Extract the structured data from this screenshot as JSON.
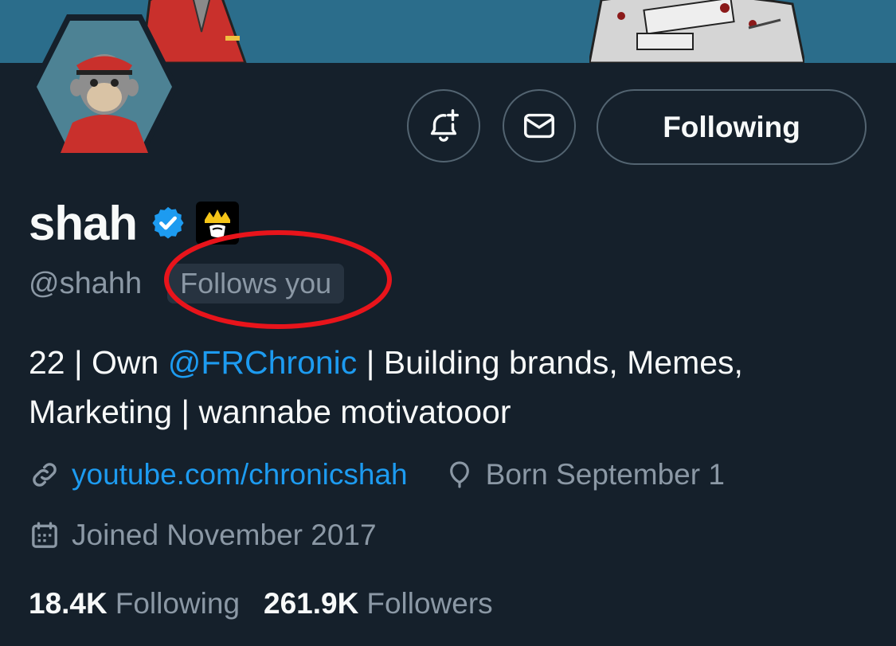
{
  "profile": {
    "display_name": "shah",
    "handle": "@shahh",
    "follows_you_label": "Follows you",
    "verified_icon": "verified-badge-icon",
    "affiliate_icon": "crown-affiliate-icon"
  },
  "actions": {
    "notify_icon": "bell-plus-icon",
    "message_icon": "envelope-icon",
    "follow_button_label": "Following"
  },
  "bio": {
    "prefix": "22 | Own ",
    "mention": "@FRChronic",
    "suffix": " | Building brands, Memes, Marketing | wannabe motivatooor"
  },
  "meta": {
    "website": "youtube.com/chronicshah",
    "birthday": "Born September 1",
    "joined": "Joined November 2017"
  },
  "stats": {
    "following_count": "18.4K",
    "following_label": "Following",
    "followers_count": "261.9K",
    "followers_label": "Followers"
  },
  "colors": {
    "background": "#15202b",
    "accent_link": "#1d9bf0",
    "muted_text": "#8b98a5",
    "annotation_red": "#e8141b"
  }
}
